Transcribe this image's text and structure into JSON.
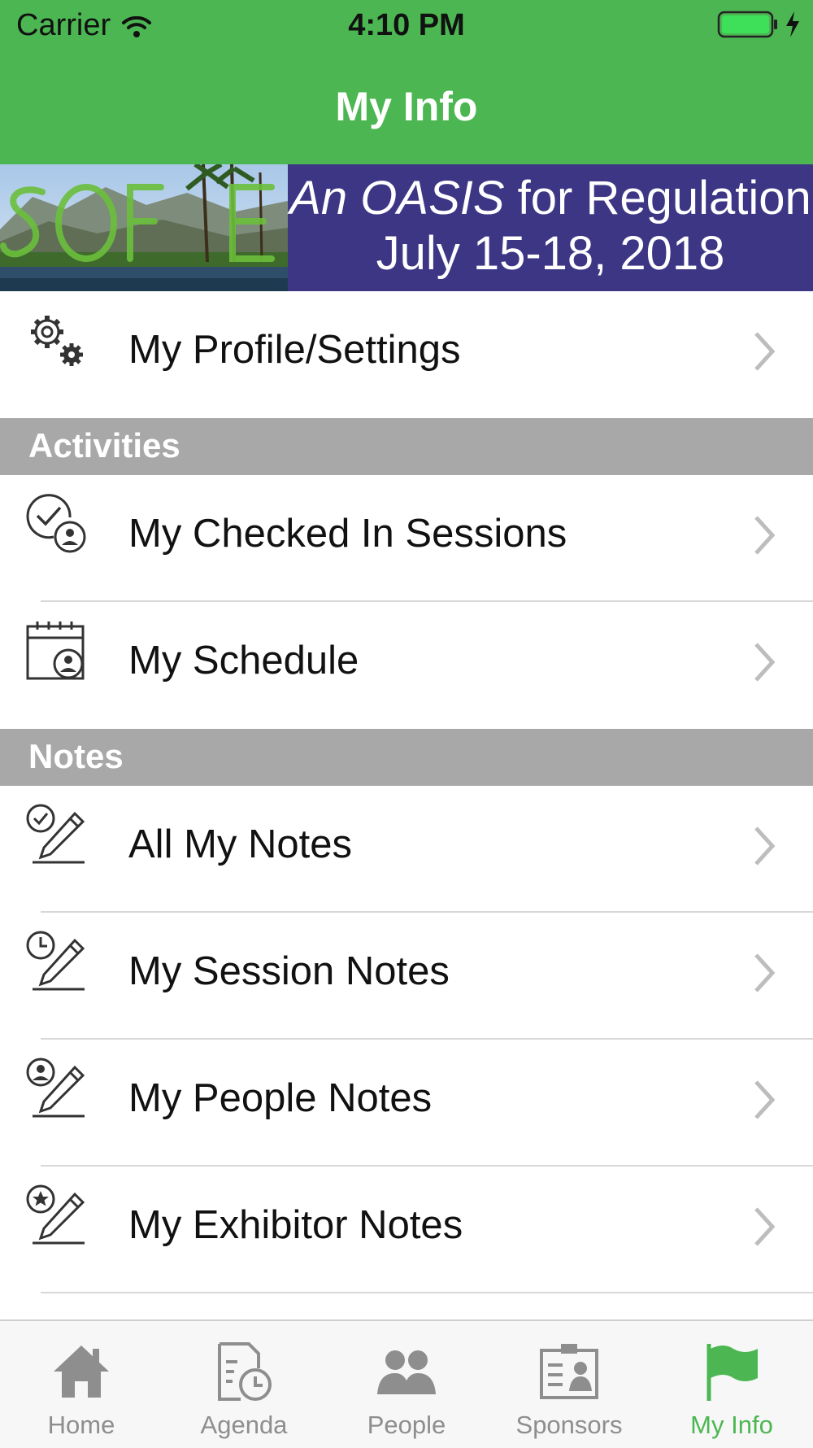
{
  "status": {
    "carrier": "Carrier",
    "time": "4:10 PM"
  },
  "nav": {
    "title": "My Info"
  },
  "banner": {
    "line1_a": "An ",
    "line1_b": "OASIS",
    "line1_c": " for Regulation",
    "line2": "July 15-18, 2018"
  },
  "rows": {
    "profile": {
      "label": "My Profile/Settings",
      "icon": "gears-icon"
    },
    "checked_in": {
      "label": "My Checked In Sessions",
      "icon": "check-person-icon"
    },
    "schedule": {
      "label": "My Schedule",
      "icon": "calendar-person-icon"
    },
    "all_notes": {
      "label": "All My Notes",
      "icon": "check-pencil-icon"
    },
    "session_notes": {
      "label": "My Session Notes",
      "icon": "clock-pencil-icon"
    },
    "people_notes": {
      "label": "My People Notes",
      "icon": "person-pencil-icon"
    },
    "exhibitor_notes": {
      "label": "My Exhibitor Notes",
      "icon": "star-pencil-icon"
    }
  },
  "sections": {
    "activities": "Activities",
    "notes": "Notes"
  },
  "tabs": [
    {
      "label": "Home",
      "icon": "home-icon"
    },
    {
      "label": "Agenda",
      "icon": "agenda-icon"
    },
    {
      "label": "People",
      "icon": "people-icon"
    },
    {
      "label": "Sponsors",
      "icon": "sponsors-icon"
    },
    {
      "label": "My Info",
      "icon": "flag-icon",
      "active": true
    }
  ],
  "colors": {
    "accent": "#4CB752",
    "section": "#A8A8A8",
    "banner_panel": "#3C3685"
  }
}
